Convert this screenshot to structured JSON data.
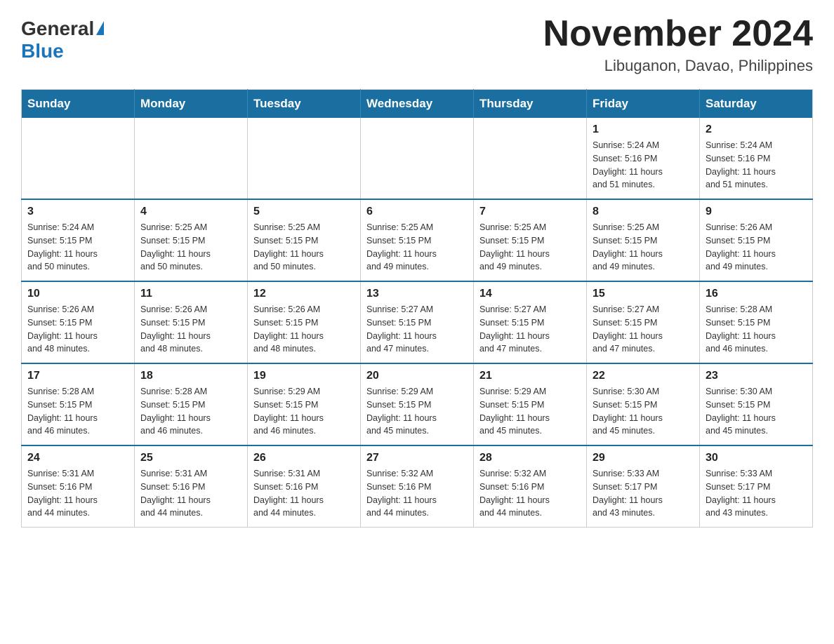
{
  "logo": {
    "general": "General",
    "triangle": "▶",
    "blue": "Blue"
  },
  "header": {
    "month": "November 2024",
    "location": "Libuganon, Davao, Philippines"
  },
  "weekdays": [
    "Sunday",
    "Monday",
    "Tuesday",
    "Wednesday",
    "Thursday",
    "Friday",
    "Saturday"
  ],
  "weeks": [
    [
      {
        "day": "",
        "info": ""
      },
      {
        "day": "",
        "info": ""
      },
      {
        "day": "",
        "info": ""
      },
      {
        "day": "",
        "info": ""
      },
      {
        "day": "",
        "info": ""
      },
      {
        "day": "1",
        "info": "Sunrise: 5:24 AM\nSunset: 5:16 PM\nDaylight: 11 hours\nand 51 minutes."
      },
      {
        "day": "2",
        "info": "Sunrise: 5:24 AM\nSunset: 5:16 PM\nDaylight: 11 hours\nand 51 minutes."
      }
    ],
    [
      {
        "day": "3",
        "info": "Sunrise: 5:24 AM\nSunset: 5:15 PM\nDaylight: 11 hours\nand 50 minutes."
      },
      {
        "day": "4",
        "info": "Sunrise: 5:25 AM\nSunset: 5:15 PM\nDaylight: 11 hours\nand 50 minutes."
      },
      {
        "day": "5",
        "info": "Sunrise: 5:25 AM\nSunset: 5:15 PM\nDaylight: 11 hours\nand 50 minutes."
      },
      {
        "day": "6",
        "info": "Sunrise: 5:25 AM\nSunset: 5:15 PM\nDaylight: 11 hours\nand 49 minutes."
      },
      {
        "day": "7",
        "info": "Sunrise: 5:25 AM\nSunset: 5:15 PM\nDaylight: 11 hours\nand 49 minutes."
      },
      {
        "day": "8",
        "info": "Sunrise: 5:25 AM\nSunset: 5:15 PM\nDaylight: 11 hours\nand 49 minutes."
      },
      {
        "day": "9",
        "info": "Sunrise: 5:26 AM\nSunset: 5:15 PM\nDaylight: 11 hours\nand 49 minutes."
      }
    ],
    [
      {
        "day": "10",
        "info": "Sunrise: 5:26 AM\nSunset: 5:15 PM\nDaylight: 11 hours\nand 48 minutes."
      },
      {
        "day": "11",
        "info": "Sunrise: 5:26 AM\nSunset: 5:15 PM\nDaylight: 11 hours\nand 48 minutes."
      },
      {
        "day": "12",
        "info": "Sunrise: 5:26 AM\nSunset: 5:15 PM\nDaylight: 11 hours\nand 48 minutes."
      },
      {
        "day": "13",
        "info": "Sunrise: 5:27 AM\nSunset: 5:15 PM\nDaylight: 11 hours\nand 47 minutes."
      },
      {
        "day": "14",
        "info": "Sunrise: 5:27 AM\nSunset: 5:15 PM\nDaylight: 11 hours\nand 47 minutes."
      },
      {
        "day": "15",
        "info": "Sunrise: 5:27 AM\nSunset: 5:15 PM\nDaylight: 11 hours\nand 47 minutes."
      },
      {
        "day": "16",
        "info": "Sunrise: 5:28 AM\nSunset: 5:15 PM\nDaylight: 11 hours\nand 46 minutes."
      }
    ],
    [
      {
        "day": "17",
        "info": "Sunrise: 5:28 AM\nSunset: 5:15 PM\nDaylight: 11 hours\nand 46 minutes."
      },
      {
        "day": "18",
        "info": "Sunrise: 5:28 AM\nSunset: 5:15 PM\nDaylight: 11 hours\nand 46 minutes."
      },
      {
        "day": "19",
        "info": "Sunrise: 5:29 AM\nSunset: 5:15 PM\nDaylight: 11 hours\nand 46 minutes."
      },
      {
        "day": "20",
        "info": "Sunrise: 5:29 AM\nSunset: 5:15 PM\nDaylight: 11 hours\nand 45 minutes."
      },
      {
        "day": "21",
        "info": "Sunrise: 5:29 AM\nSunset: 5:15 PM\nDaylight: 11 hours\nand 45 minutes."
      },
      {
        "day": "22",
        "info": "Sunrise: 5:30 AM\nSunset: 5:15 PM\nDaylight: 11 hours\nand 45 minutes."
      },
      {
        "day": "23",
        "info": "Sunrise: 5:30 AM\nSunset: 5:15 PM\nDaylight: 11 hours\nand 45 minutes."
      }
    ],
    [
      {
        "day": "24",
        "info": "Sunrise: 5:31 AM\nSunset: 5:16 PM\nDaylight: 11 hours\nand 44 minutes."
      },
      {
        "day": "25",
        "info": "Sunrise: 5:31 AM\nSunset: 5:16 PM\nDaylight: 11 hours\nand 44 minutes."
      },
      {
        "day": "26",
        "info": "Sunrise: 5:31 AM\nSunset: 5:16 PM\nDaylight: 11 hours\nand 44 minutes."
      },
      {
        "day": "27",
        "info": "Sunrise: 5:32 AM\nSunset: 5:16 PM\nDaylight: 11 hours\nand 44 minutes."
      },
      {
        "day": "28",
        "info": "Sunrise: 5:32 AM\nSunset: 5:16 PM\nDaylight: 11 hours\nand 44 minutes."
      },
      {
        "day": "29",
        "info": "Sunrise: 5:33 AM\nSunset: 5:17 PM\nDaylight: 11 hours\nand 43 minutes."
      },
      {
        "day": "30",
        "info": "Sunrise: 5:33 AM\nSunset: 5:17 PM\nDaylight: 11 hours\nand 43 minutes."
      }
    ]
  ]
}
